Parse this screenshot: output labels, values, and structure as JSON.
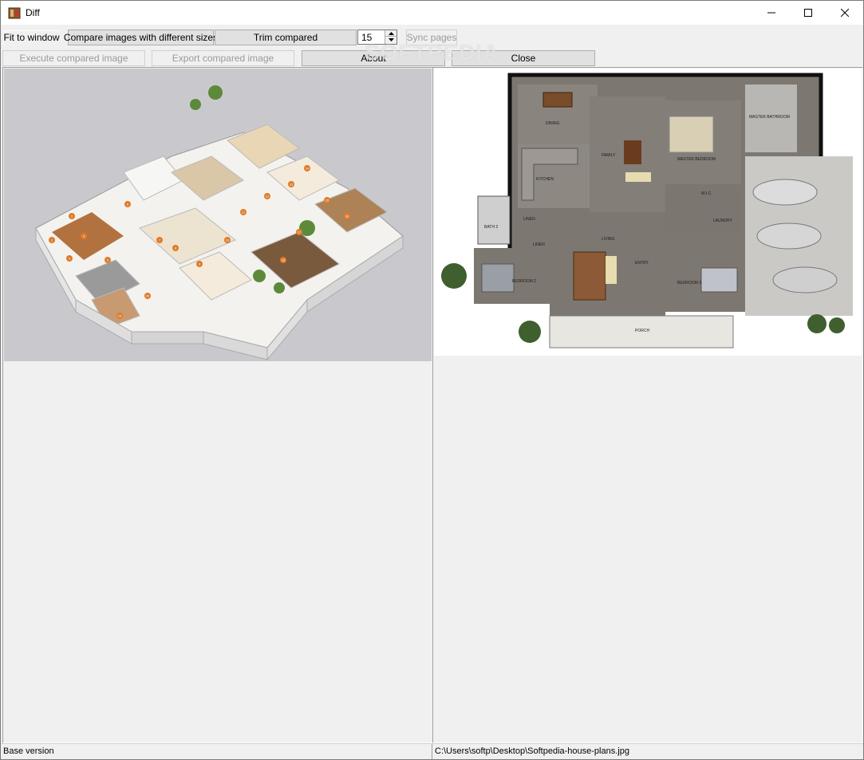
{
  "window": {
    "title": "Diff"
  },
  "toolbar": {
    "fit_to_window": "Fit to window",
    "compare_sizes": "Compare images with different sizes",
    "trim_compared": "Trim compared",
    "threshold_value": "15",
    "sync_pages": "Sync pages",
    "execute_compared": "Execute compared image",
    "export_compared": "Export compared image",
    "about": "About",
    "close": "Close"
  },
  "watermark": "SOFTPEDIA",
  "status": {
    "left": "Base version",
    "right": "C:\\Users\\softp\\Desktop\\Softpedia-house-plans.jpg"
  },
  "left_image_labels": [
    "1",
    "2",
    "3",
    "4",
    "5",
    "6",
    "7",
    "8",
    "9",
    "10",
    "11",
    "12",
    "13",
    "14",
    "15",
    "16",
    "17",
    "18",
    "19",
    "20"
  ],
  "floor_plan": {
    "rooms": {
      "dining": "DINING",
      "kitchen": "KITCHEN",
      "family": "FAMILY",
      "master_bedroom": "MASTER BEDROOM",
      "master_bath": "MASTER BATHROOM",
      "wic": "W.I.C.",
      "laundry": "LAUNDRY",
      "linen": "LINEN",
      "linen2": "LINEN",
      "bath2": "BATH 2",
      "bedroom2": "BEDROOM 2",
      "bedroom3": "BEDROOM 3",
      "living": "LIVING",
      "entry": "ENTRY",
      "porch": "PORCH"
    }
  },
  "colors": {
    "window_bg": "#f0f0f0",
    "accent_orange": "#e07b2a"
  }
}
